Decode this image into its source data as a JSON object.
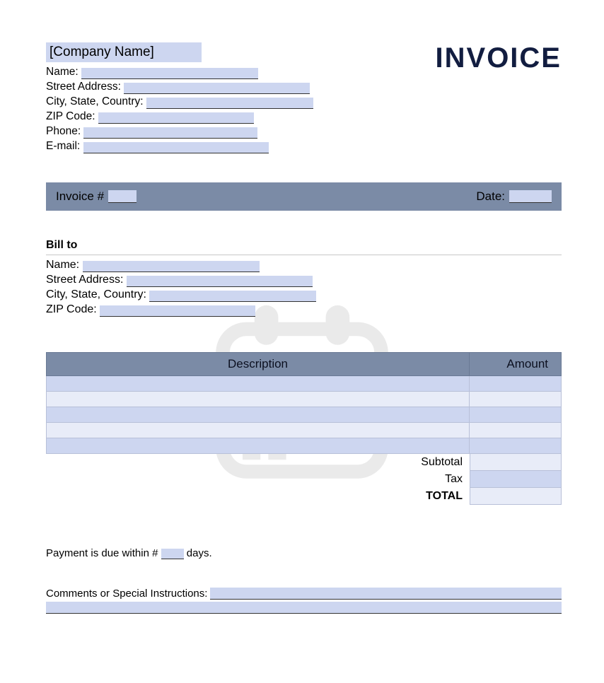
{
  "header": {
    "company_placeholder": "[Company Name]",
    "invoice_title": "INVOICE",
    "fields": {
      "name_label": "Name:",
      "street_label": "Street Address:",
      "city_label": "City, State, Country:",
      "zip_label": "ZIP Code:",
      "phone_label": "Phone:",
      "email_label": "E-mail:"
    }
  },
  "info_bar": {
    "invoice_num_label": "Invoice #",
    "date_label": "Date:"
  },
  "bill_to": {
    "title": "Bill to",
    "name_label": "Name:",
    "street_label": "Street Address:",
    "city_label": "City, State, Country:",
    "zip_label": "ZIP Code:"
  },
  "table": {
    "description_header": "Description",
    "amount_header": "Amount"
  },
  "totals": {
    "subtotal_label": "Subtotal",
    "tax_label": "Tax",
    "total_label": "TOTAL"
  },
  "payment": {
    "prefix": "Payment is due within #",
    "suffix": "days."
  },
  "comments": {
    "label": "Comments or Special Instructions:"
  }
}
